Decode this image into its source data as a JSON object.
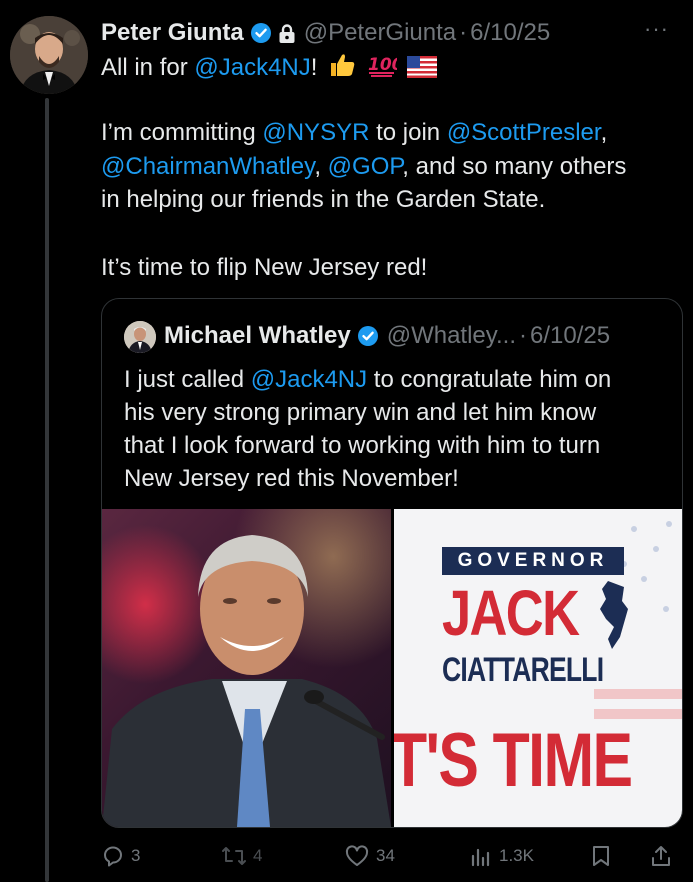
{
  "tweet": {
    "author_name": "Peter Giunta",
    "handle": "@PeterGiunta",
    "separator": "·",
    "date": "6/10/25",
    "more_label": "···",
    "line1_text": "All in for ",
    "line1_mention": "@Jack4NJ",
    "line1_after": "!",
    "line2_pre": "I’m committing ",
    "line2_m1": "@NYSYR",
    "line2_mid": " to join ",
    "line2_m2": "@ScottPresler",
    "line2_post": ",",
    "line3_m1": "@ChairmanWhatley",
    "line3_mid": ", ",
    "line3_m2": "@GOP",
    "line3_post": ", and so many others",
    "line4": "in helping our friends in the Garden State.",
    "line5": "It’s time to flip New Jersey red!"
  },
  "quote": {
    "author_name": "Michael Whatley",
    "handle": "@Whatley...",
    "separator": "·",
    "date": "6/10/25",
    "line1_pre": "I just called ",
    "line1_mention": "@Jack4NJ",
    "line1_post": " to congratulate him on",
    "line2": "his very strong primary win and let him know",
    "line3": "that I look forward to working with him to turn",
    "line4": "New Jersey red this November!",
    "image_right": {
      "governor_label": "GOVERNOR",
      "jack_label": "JACK",
      "surname_label": "CIATTARELLI",
      "slogan_label": "T'S TIME"
    }
  },
  "actions": {
    "replies": "3",
    "reposts": "4",
    "likes": "34",
    "views": "1.3K"
  },
  "colors": {
    "background": "#000000",
    "text": "#e7e9ea",
    "secondary": "#71767b",
    "accent": "#1d9bf0",
    "verified": "#1d9bf0",
    "campaign_red": "#d32b36",
    "campaign_navy": "#1c2d54"
  },
  "icons": [
    "verified-icon",
    "lock-icon",
    "more-icon",
    "thumbs-up-emoji",
    "hundred-emoji",
    "us-flag-emoji",
    "reply-icon",
    "repost-icon",
    "like-icon",
    "views-icon",
    "bookmark-icon",
    "share-icon",
    "new-jersey-map-icon"
  ]
}
